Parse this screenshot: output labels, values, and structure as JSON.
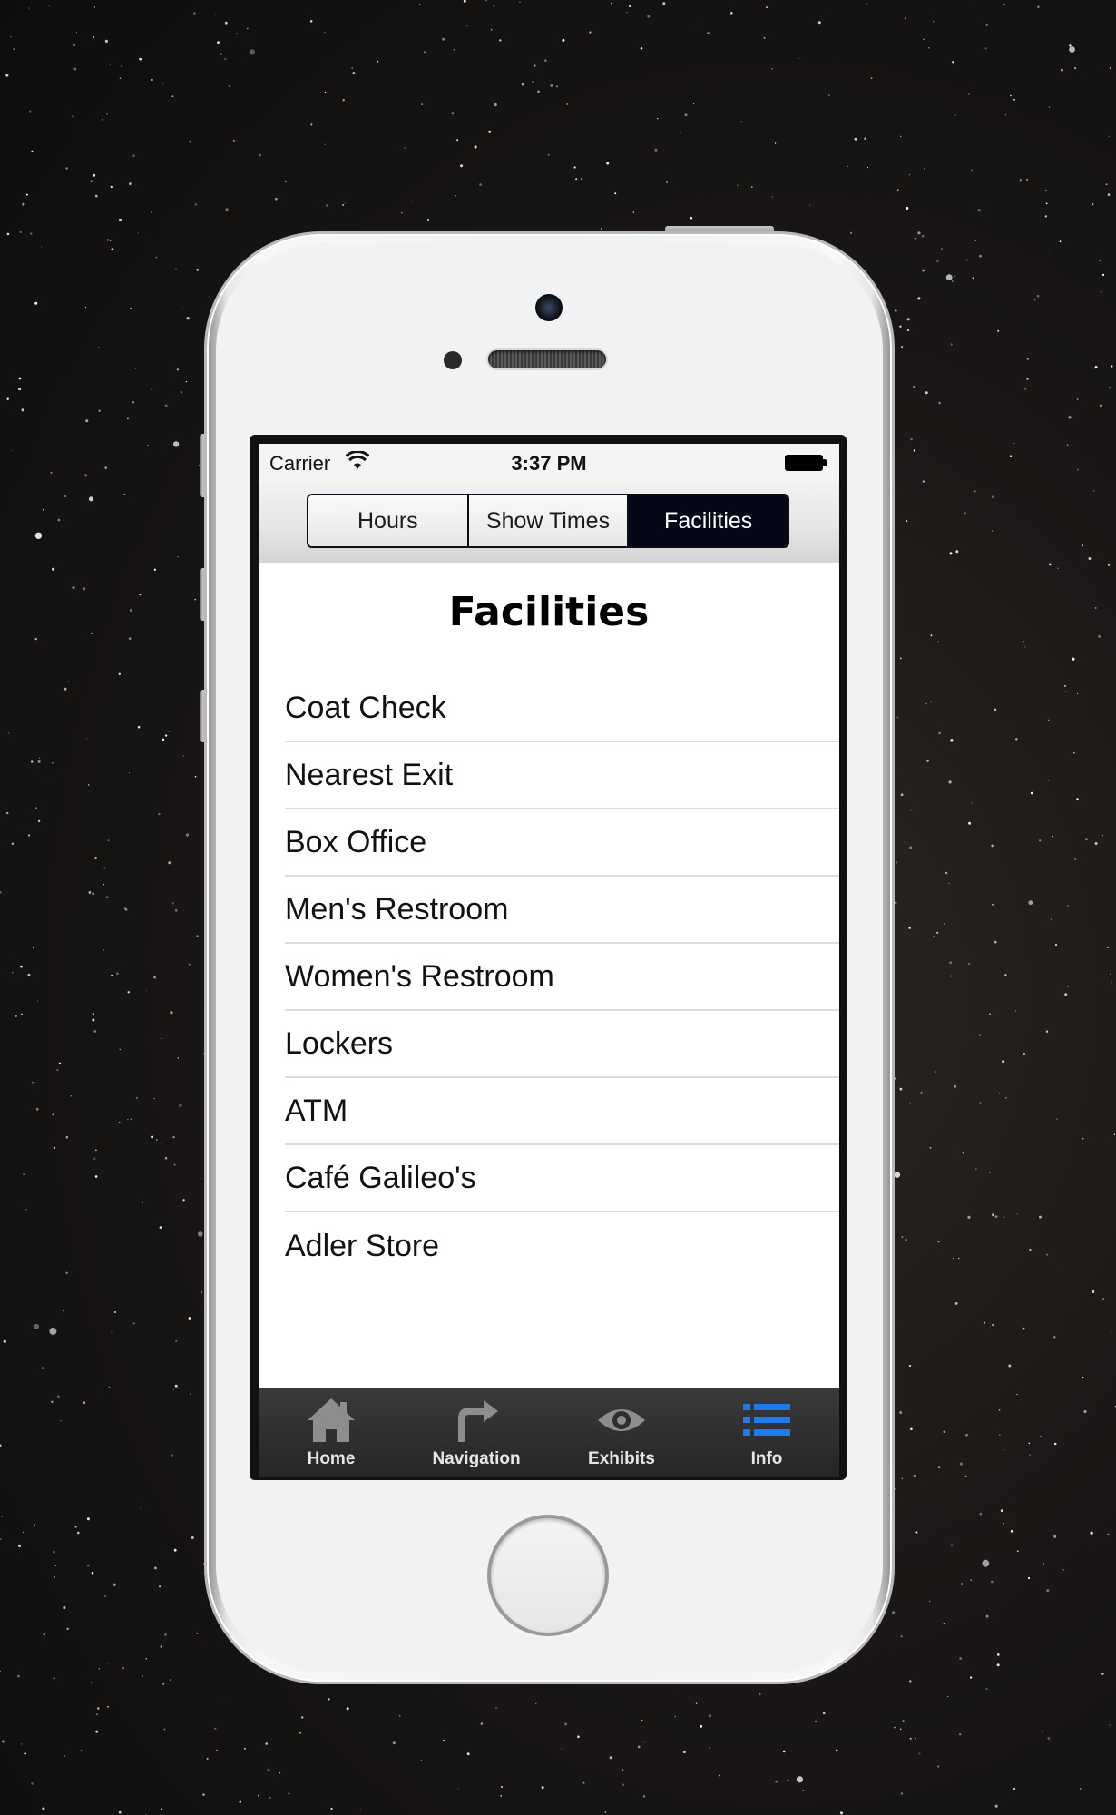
{
  "status_bar": {
    "carrier": "Carrier",
    "time": "3:37 PM"
  },
  "segmented_control": {
    "segments": [
      {
        "label": "Hours",
        "active": false
      },
      {
        "label": "Show Times",
        "active": false
      },
      {
        "label": "Facilities",
        "active": true
      }
    ]
  },
  "page": {
    "title": "Facilities"
  },
  "facilities": [
    "Coat Check",
    "Nearest Exit",
    "Box Office",
    "Men's Restroom",
    "Women's Restroom",
    "Lockers",
    "ATM",
    "Café Galileo's",
    "Adler Store"
  ],
  "tab_bar": {
    "tabs": [
      {
        "label": "Home",
        "icon": "home-icon",
        "active": false
      },
      {
        "label": "Navigation",
        "icon": "turn-arrow-icon",
        "active": false
      },
      {
        "label": "Exhibits",
        "icon": "eye-icon",
        "active": false
      },
      {
        "label": "Info",
        "icon": "list-icon",
        "active": true
      }
    ]
  },
  "colors": {
    "active_tab": "#1a7cf2",
    "inactive_tab": "#8d8d8d",
    "segment_active": "#060818"
  }
}
